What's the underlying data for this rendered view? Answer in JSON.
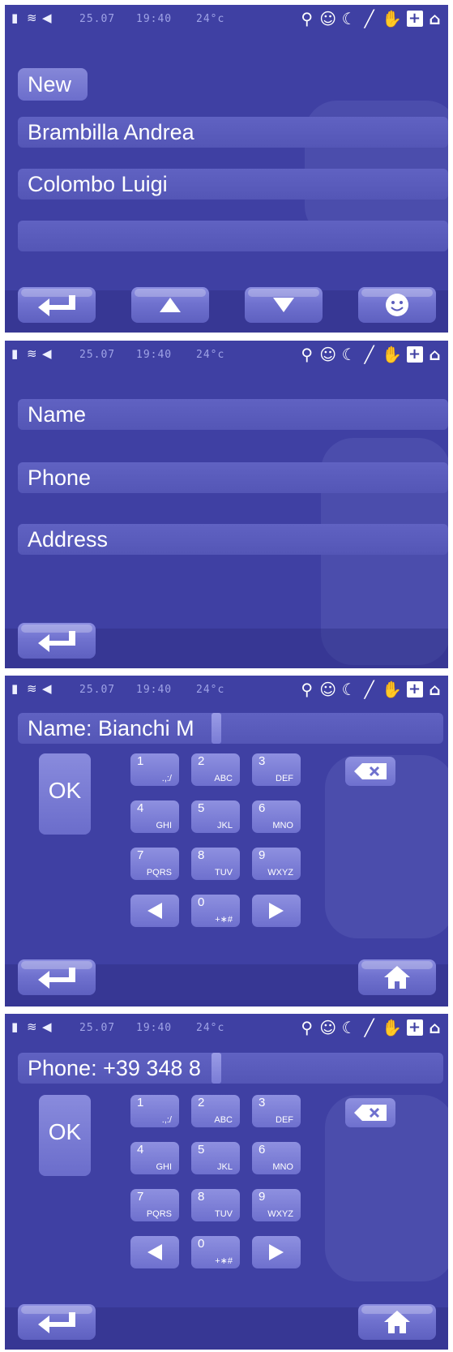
{
  "status": {
    "date": "25.07",
    "time": "19:40",
    "temp": "24°c"
  },
  "screen1": {
    "new_label": "New",
    "contacts": [
      "Brambilla Andrea",
      "Colombo Luigi",
      ""
    ]
  },
  "screen2": {
    "fields": [
      "Name",
      "Phone",
      "Address"
    ]
  },
  "screen3": {
    "input_value": "Name: Bianchi M"
  },
  "screen4": {
    "input_value": "Phone: +39 348 8"
  },
  "keypad": {
    "ok_label": "OK",
    "keys": [
      {
        "digit": "1",
        "letters": ".,:/"
      },
      {
        "digit": "2",
        "letters": "ABC"
      },
      {
        "digit": "3",
        "letters": "DEF"
      },
      {
        "digit": "4",
        "letters": "GHI"
      },
      {
        "digit": "5",
        "letters": "JKL"
      },
      {
        "digit": "6",
        "letters": "MNO"
      },
      {
        "digit": "7",
        "letters": "PQRS"
      },
      {
        "digit": "8",
        "letters": "TUV"
      },
      {
        "digit": "9",
        "letters": "WXYZ"
      },
      {
        "digit": "0",
        "letters": "+∗#"
      }
    ]
  },
  "icons": {
    "status_left": [
      "battery-icon",
      "wifi-icon",
      "speaker-icon"
    ],
    "status_right": [
      "search-icon",
      "chat-icon",
      "moon-icon",
      "pen-icon",
      "hand-icon",
      "plus-icon",
      "network-icon"
    ],
    "nav": [
      "back-icon",
      "up-icon",
      "down-icon",
      "smiley-icon",
      "home-icon",
      "backspace-icon",
      "left-icon",
      "right-icon"
    ]
  },
  "colors": {
    "background": "#3f40a3",
    "button": "#7f81d8",
    "text": "#ffffff"
  }
}
